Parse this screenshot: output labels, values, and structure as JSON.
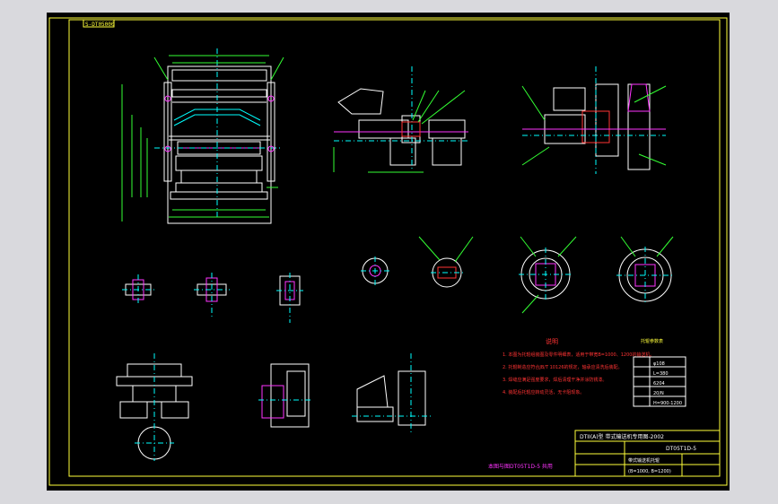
{
  "drawing": {
    "tab_label": "S-DT05000",
    "block_title": "DTII(A)型  带式输送机专用图-2002",
    "drawing_number": "DT05T1D-5",
    "part_name": "带式输送机托辊",
    "part_spec": "(B=1000, B=1200)",
    "note_title": "说明",
    "notes": [
      "1. 本图为托辊组装图及零件明细表，适用于带宽B=1000、1200的输送机。",
      "2. 托辊制造应符合JB/T 10126的规定，轴承应清洗后装配。",
      "3. 焊缝应满足强度要求，焊后清理干净并涂防锈漆。",
      "4. 装配后托辊应转动灵活，无卡阻现象。"
    ],
    "bottom_note": "本图与图DT05T1D-5 共用",
    "table_title": "托辊参数表",
    "table_rows": [
      "φ108",
      "L=380",
      "6204",
      "20/N",
      "H=900-1200"
    ]
  },
  "colors": {
    "frame": "#ffff3a",
    "line": "#ffffff",
    "dimension": "#33ff33",
    "annotation": "#00ffff",
    "accent": "#ff33ff",
    "hatch": "#ff3333",
    "background": "#000000"
  }
}
